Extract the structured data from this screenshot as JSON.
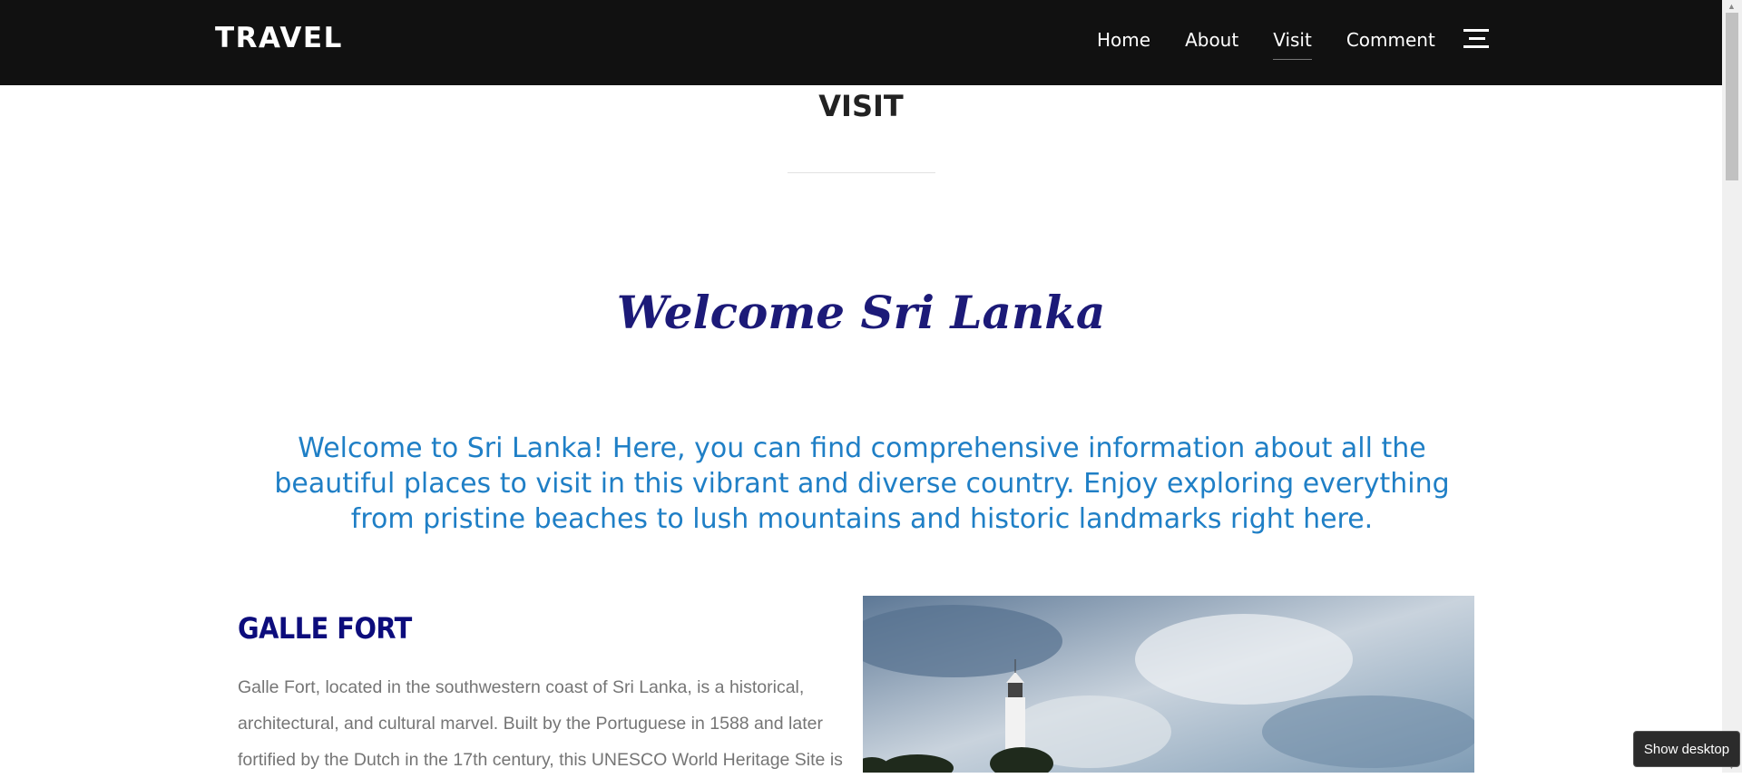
{
  "nav": {
    "brand": "TRAVEL",
    "items": [
      {
        "label": "Home"
      },
      {
        "label": "About"
      },
      {
        "label": "Visit",
        "active": true
      },
      {
        "label": "Comment"
      }
    ]
  },
  "section": {
    "title": "VISIT"
  },
  "welcome": {
    "title": "Welcome Sri Lanka",
    "intro": "Welcome to Sri Lanka! Here, you can find comprehensive information about all the beautiful places to visit in this vibrant and diverse country. Enjoy exploring everything from pristine beaches to lush mountains and historic landmarks right here."
  },
  "places": [
    {
      "title": "GALLE FORT",
      "description": "Galle Fort, located in the southwestern coast of Sri Lanka, is a historical, architectural, and cultural marvel. Built by the Portuguese in 1588 and later fortified by the Dutch in the 17th century, this UNESCO World Heritage Site is"
    }
  ],
  "tooltip": {
    "label": "Show desktop"
  },
  "colors": {
    "nav_bg": "#111111",
    "welcome": "#1c1a78",
    "intro": "#1f7fc6",
    "heading": "#0c0c7c",
    "body": "#757575"
  }
}
